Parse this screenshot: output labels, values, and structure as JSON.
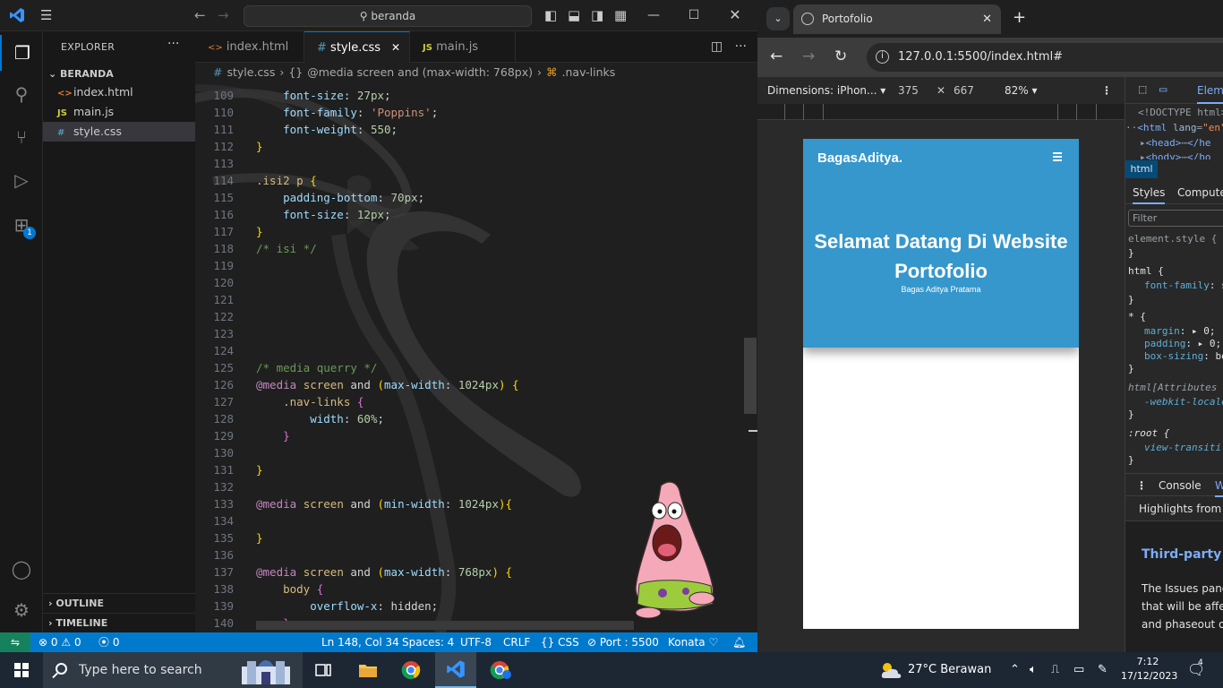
{
  "vscode": {
    "search_text": "beranda",
    "explorer_title": "EXPLORER",
    "folder_name": "BERANDA",
    "files": [
      {
        "icon": "<>",
        "name": "index.html"
      },
      {
        "icon": "JS",
        "name": "main.js"
      },
      {
        "icon": "#",
        "name": "style.css"
      }
    ],
    "outline_label": "OUTLINE",
    "timeline_label": "TIMELINE",
    "extensions_badge": "1",
    "tabs": [
      {
        "icon": "<>",
        "label": "index.html"
      },
      {
        "icon": "#",
        "label": "style.css"
      },
      {
        "icon": "JS",
        "label": "main.js"
      }
    ],
    "breadcrumb": {
      "file": "style.css",
      "media": "@media screen and (max-width: 768px)",
      "selector": ".nav-links"
    },
    "code": [
      {
        "n": "109",
        "parts": [
          {
            "c": "prop",
            "t": "    font-size"
          },
          {
            "c": "plain",
            "t": ": "
          },
          {
            "c": "num",
            "t": "27px"
          },
          {
            "c": "plain",
            "t": ";"
          }
        ]
      },
      {
        "n": "110",
        "parts": [
          {
            "c": "prop",
            "t": "    font-family"
          },
          {
            "c": "plain",
            "t": ": "
          },
          {
            "c": "str",
            "t": "'Poppins'"
          },
          {
            "c": "plain",
            "t": ";"
          }
        ]
      },
      {
        "n": "111",
        "parts": [
          {
            "c": "prop",
            "t": "    font-weight"
          },
          {
            "c": "plain",
            "t": ": "
          },
          {
            "c": "num",
            "t": "550"
          },
          {
            "c": "plain",
            "t": ";"
          }
        ]
      },
      {
        "n": "112",
        "parts": [
          {
            "c": "br",
            "t": "}"
          }
        ]
      },
      {
        "n": "113",
        "parts": []
      },
      {
        "n": "114",
        "parts": [
          {
            "c": "sel",
            "t": ".isi2 p"
          },
          {
            "c": "plain",
            "t": " "
          },
          {
            "c": "br",
            "t": "{"
          }
        ]
      },
      {
        "n": "115",
        "parts": [
          {
            "c": "prop",
            "t": "    padding-bottom"
          },
          {
            "c": "plain",
            "t": ": "
          },
          {
            "c": "num",
            "t": "70px"
          },
          {
            "c": "plain",
            "t": ";"
          }
        ]
      },
      {
        "n": "116",
        "parts": [
          {
            "c": "prop",
            "t": "    font-size"
          },
          {
            "c": "plain",
            "t": ": "
          },
          {
            "c": "num",
            "t": "12px"
          },
          {
            "c": "plain",
            "t": ";"
          }
        ]
      },
      {
        "n": "117",
        "parts": [
          {
            "c": "br",
            "t": "}"
          }
        ]
      },
      {
        "n": "118",
        "parts": [
          {
            "c": "cmt",
            "t": "/* isi */"
          }
        ]
      },
      {
        "n": "119",
        "parts": []
      },
      {
        "n": "120",
        "parts": []
      },
      {
        "n": "121",
        "parts": []
      },
      {
        "n": "122",
        "parts": []
      },
      {
        "n": "123",
        "parts": []
      },
      {
        "n": "124",
        "parts": []
      },
      {
        "n": "125",
        "parts": [
          {
            "c": "cmt",
            "t": "/* media querry */"
          }
        ]
      },
      {
        "n": "126",
        "parts": [
          {
            "c": "at",
            "t": "@media"
          },
          {
            "c": "plain",
            "t": " "
          },
          {
            "c": "sel",
            "t": "screen"
          },
          {
            "c": "plain",
            "t": " and "
          },
          {
            "c": "br",
            "t": "("
          },
          {
            "c": "prop",
            "t": "max-width"
          },
          {
            "c": "plain",
            "t": ": "
          },
          {
            "c": "num",
            "t": "1024px"
          },
          {
            "c": "br",
            "t": ")"
          },
          {
            "c": "plain",
            "t": " "
          },
          {
            "c": "br",
            "t": "{"
          }
        ]
      },
      {
        "n": "127",
        "parts": [
          {
            "c": "sel",
            "t": "    .nav-links"
          },
          {
            "c": "plain",
            "t": " "
          },
          {
            "c": "br2",
            "t": "{"
          }
        ]
      },
      {
        "n": "128",
        "parts": [
          {
            "c": "prop",
            "t": "        width"
          },
          {
            "c": "plain",
            "t": ": "
          },
          {
            "c": "num",
            "t": "60%"
          },
          {
            "c": "plain",
            "t": ";"
          }
        ]
      },
      {
        "n": "129",
        "parts": [
          {
            "c": "br2",
            "t": "    }"
          }
        ]
      },
      {
        "n": "130",
        "parts": []
      },
      {
        "n": "131",
        "parts": [
          {
            "c": "br",
            "t": "}"
          }
        ]
      },
      {
        "n": "132",
        "parts": []
      },
      {
        "n": "133",
        "parts": [
          {
            "c": "at",
            "t": "@media"
          },
          {
            "c": "plain",
            "t": " "
          },
          {
            "c": "sel",
            "t": "screen"
          },
          {
            "c": "plain",
            "t": " and "
          },
          {
            "c": "br",
            "t": "("
          },
          {
            "c": "prop",
            "t": "min-width"
          },
          {
            "c": "plain",
            "t": ": "
          },
          {
            "c": "num",
            "t": "1024px"
          },
          {
            "c": "br",
            "t": "){"
          }
        ]
      },
      {
        "n": "134",
        "parts": []
      },
      {
        "n": "135",
        "parts": [
          {
            "c": "br",
            "t": "}"
          }
        ]
      },
      {
        "n": "136",
        "parts": []
      },
      {
        "n": "137",
        "parts": [
          {
            "c": "at",
            "t": "@media"
          },
          {
            "c": "plain",
            "t": " "
          },
          {
            "c": "sel",
            "t": "screen"
          },
          {
            "c": "plain",
            "t": " and "
          },
          {
            "c": "br",
            "t": "("
          },
          {
            "c": "prop",
            "t": "max-width"
          },
          {
            "c": "plain",
            "t": ": "
          },
          {
            "c": "num",
            "t": "768px"
          },
          {
            "c": "br",
            "t": ")"
          },
          {
            "c": "plain",
            "t": " "
          },
          {
            "c": "br",
            "t": "{"
          }
        ]
      },
      {
        "n": "138",
        "parts": [
          {
            "c": "sel",
            "t": "    body"
          },
          {
            "c": "plain",
            "t": " "
          },
          {
            "c": "br2",
            "t": "{"
          }
        ]
      },
      {
        "n": "139",
        "parts": [
          {
            "c": "prop",
            "t": "        overflow-x"
          },
          {
            "c": "plain",
            "t": ": "
          },
          {
            "c": "plain",
            "t": "hidden;"
          }
        ]
      },
      {
        "n": "140",
        "parts": [
          {
            "c": "br2",
            "t": "    }"
          }
        ]
      }
    ],
    "status": {
      "errors": "0",
      "warnings": "0",
      "ports": "0",
      "position": "Ln 148, Col 34",
      "spaces": "Spaces: 4",
      "encoding": "UTF-8",
      "eol": "CRLF",
      "language": "CSS",
      "port": "Port : 5500",
      "user": "Konata"
    },
    "accent": "#007acc"
  },
  "chrome": {
    "tab_title": "Portofolio",
    "url": "127.0.0.1:5500/index.html#",
    "device": {
      "name": "Dimensions: iPhon...",
      "width": "375",
      "height": "667",
      "zoom": "82%"
    },
    "page": {
      "logo": "BagasAditya.",
      "title": "Selamat Datang Di Website Portofolio",
      "subtitle": "Bagas Aditya Pratama",
      "hero_color": "#3697cc"
    },
    "devtools": {
      "panel_tab": "Eleme",
      "crumb": "html",
      "styles_tab": "Styles",
      "computed_tab": "Compute",
      "filter_placeholder": "Filter",
      "console_tab": "Console",
      "whats_new_tab": "W",
      "highlights": "Highlights from th",
      "issue_title": "Third-party",
      "issue_lines": [
        "The Issues pane",
        "that will be affe",
        "and phaseout o"
      ]
    }
  },
  "taskbar": {
    "search_placeholder": "Type here to search",
    "weather": "27°C  Berawan",
    "time": "7:12",
    "date": "17/12/2023",
    "notifications": "4"
  }
}
